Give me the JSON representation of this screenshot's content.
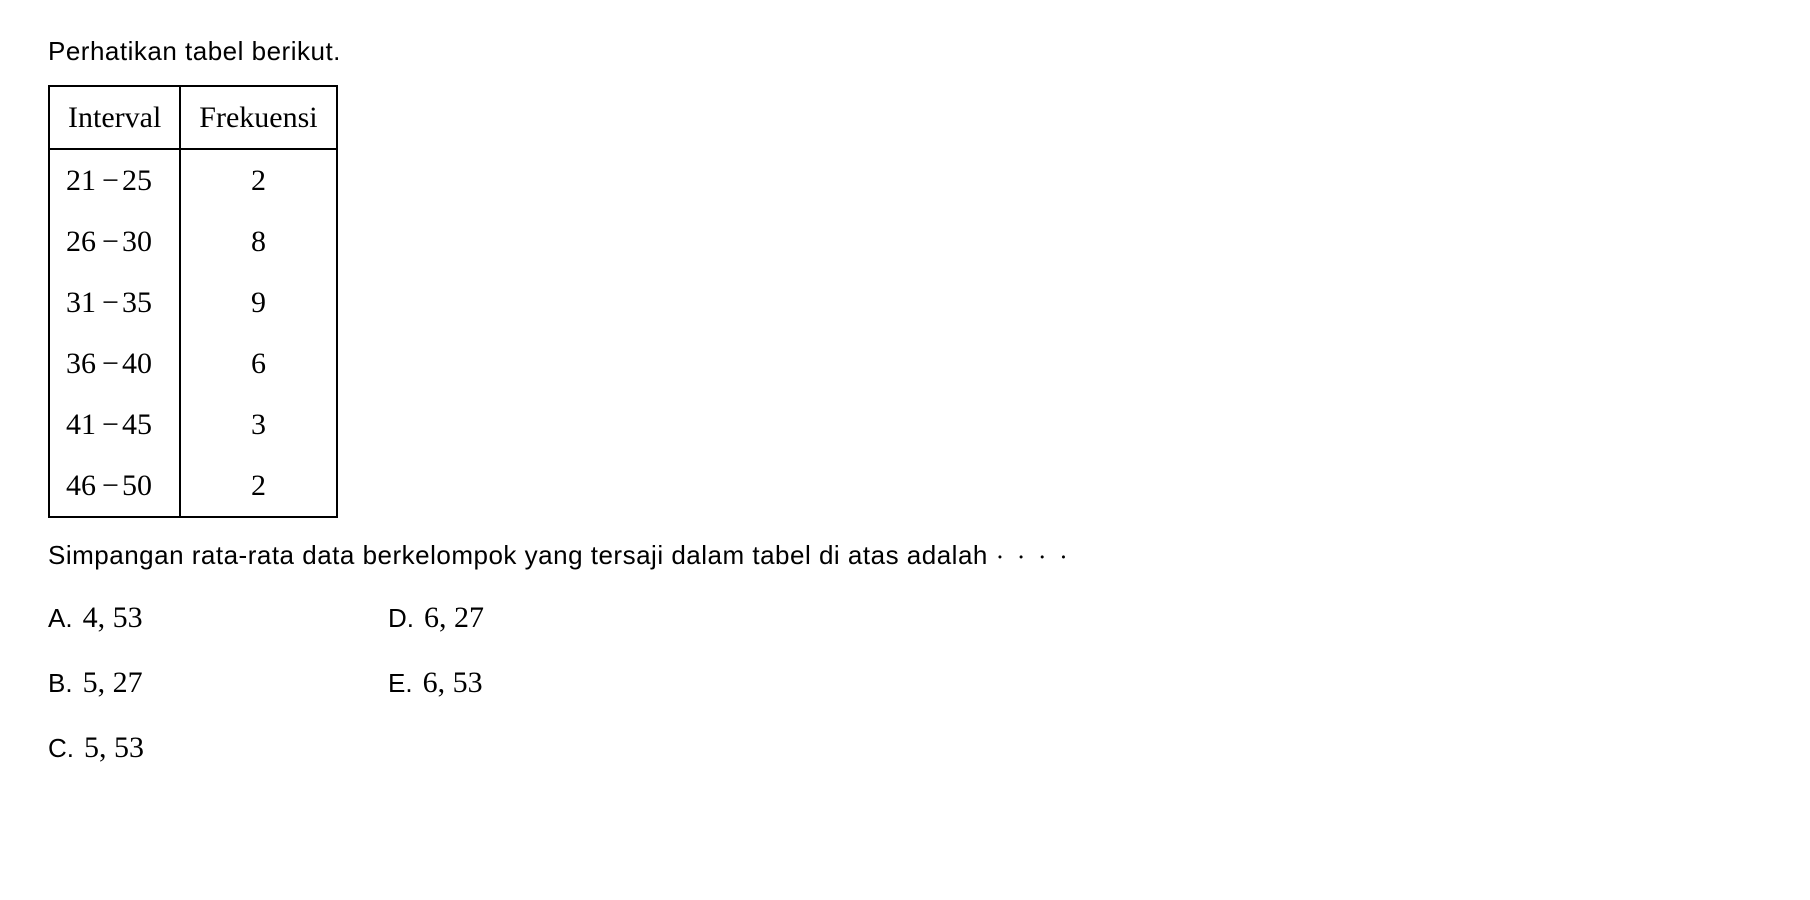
{
  "intro_text": "Perhatikan tabel berikut.",
  "table": {
    "headers": [
      "Interval",
      "Frekuensi"
    ],
    "rows": [
      {
        "interval_low": "21",
        "interval_high": "25",
        "freq": "2"
      },
      {
        "interval_low": "26",
        "interval_high": "30",
        "freq": "8"
      },
      {
        "interval_low": "31",
        "interval_high": "35",
        "freq": "9"
      },
      {
        "interval_low": "36",
        "interval_high": "40",
        "freq": "6"
      },
      {
        "interval_low": "41",
        "interval_high": "45",
        "freq": "3"
      },
      {
        "interval_low": "46",
        "interval_high": "50",
        "freq": "2"
      }
    ]
  },
  "question_text": "Simpangan rata-rata data berkelompok yang tersaji dalam tabel di atas adalah",
  "ellipsis": "· · · ·",
  "options": {
    "a": {
      "letter": "A.",
      "value": "4, 53"
    },
    "b": {
      "letter": "B.",
      "value": "5, 27"
    },
    "c": {
      "letter": "C.",
      "value": "5, 53"
    },
    "d": {
      "letter": "D.",
      "value": "6, 27"
    },
    "e": {
      "letter": "E.",
      "value": "6, 53"
    }
  },
  "symbols": {
    "minus": "−"
  }
}
